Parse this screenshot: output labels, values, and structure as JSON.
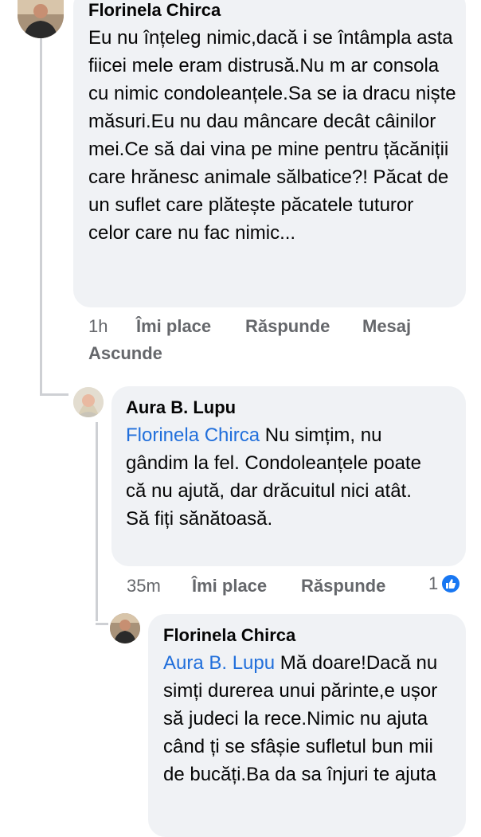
{
  "comment1": {
    "author": "Florinela Chirca",
    "text": "Eu nu înțeleg nimic,dacă i se întâmpla asta fiicei mele eram distrusă.Nu m ar consola cu nimic condoleanțele.Sa se ia dracu niște măsuri.Eu nu dau mâncare decât câinilor mei.Ce să dai vina pe mine pentru țăcăniții care hrănesc animale sălbatice?! Păcat de un suflet care plătește păcatele tuturor celor care nu fac nimic...",
    "time": "1h",
    "like_label": "Îmi place",
    "reply_label": "Răspunde",
    "message_label": "Mesaj",
    "hide_label": "Ascunde"
  },
  "comment2": {
    "author": "Aura B. Lupu",
    "mention": "Florinela Chirca",
    "text": " Nu simțim, nu gândim la fel. Condoleanțele poate că nu ajută, dar drăcuitul nici atât. Să fiți sănătoasă.",
    "time": "35m",
    "like_label": "Îmi place",
    "reply_label": "Răspunde",
    "reaction_count": "1",
    "reaction_icon": "thumbs-up-icon"
  },
  "comment3": {
    "author": "Florinela Chirca",
    "mention": "Aura B. Lupu",
    "text": " Mă doare!Dacă nu simți durerea unui părinte,e ușor să judeci la rece.Nimic nu ajuta când ți se sfâșie sufletul bun mii de bucăți.Ba da sa înjuri te ajuta"
  },
  "colors": {
    "bubble": "#f0f2f5",
    "mention": "#216fdb",
    "meta": "#65676b",
    "like": "#1877f2"
  }
}
